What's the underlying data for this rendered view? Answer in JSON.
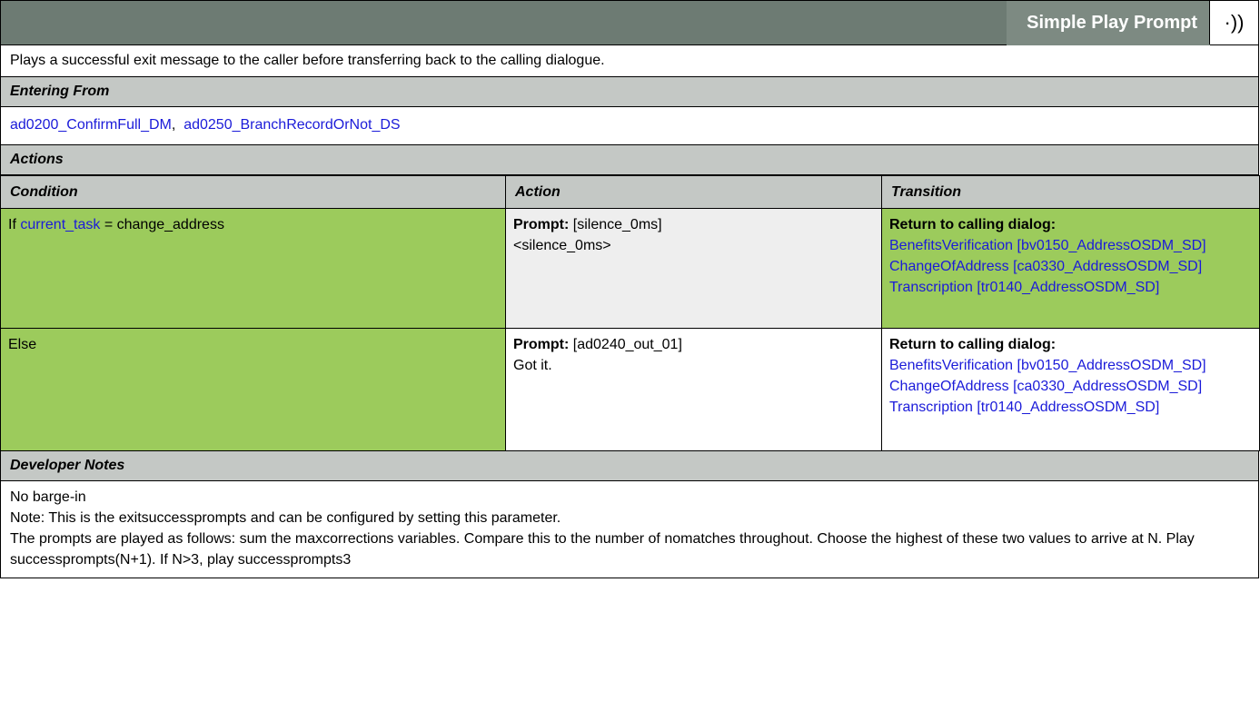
{
  "header": {
    "title": "Simple Play Prompt",
    "icon": "speaker-icon",
    "icon_glyph": "·))"
  },
  "description": "Plays a successful exit message to the caller before transferring back to the calling dialogue.",
  "entering_from": {
    "label": "Entering From",
    "links": [
      "ad0200_ConfirmFull_DM",
      "ad0250_BranchRecordOrNot_DS"
    ],
    "separator": ","
  },
  "actions": {
    "label": "Actions",
    "columns": [
      "Condition",
      "Action",
      "Transition"
    ],
    "rows": [
      {
        "cond_prefix": "If ",
        "cond_link": "current_task",
        "cond_suffix": " = change_address",
        "prompt_label": "Prompt:",
        "prompt_id": " [silence_0ms]",
        "prompt_text": "<silence_0ms>",
        "transition_label": "Return to calling dialog:",
        "transitions": [
          "BenefitsVerification [bv0150_AddressOSDM_SD]",
          "ChangeOfAddress [ca0330_AddressOSDM_SD]",
          "Transcription [tr0140_AddressOSDM_SD]"
        ]
      },
      {
        "cond_text": "Else",
        "prompt_label": "Prompt:",
        "prompt_id": " [ad0240_out_01]",
        "prompt_text": "Got it.",
        "transition_label": "Return to calling dialog:",
        "transitions": [
          "BenefitsVerification [bv0150_AddressOSDM_SD]",
          "ChangeOfAddress [ca0330_AddressOSDM_SD]",
          "Transcription [tr0140_AddressOSDM_SD]"
        ]
      }
    ]
  },
  "developer_notes": {
    "label": "Developer Notes",
    "lines": [
      "No barge-in",
      "Note: This is the exitsuccessprompts and can be configured by setting this parameter.",
      "The prompts are played as follows: sum the maxcorrections variables. Compare this to the number of nomatches throughout. Choose the highest of these two values to arrive at N. Play successprompts(N+1). If N>3,  play successprompts3"
    ]
  },
  "colors": {
    "title_bar": "#6d7b73",
    "section": "#c4c8c5",
    "green": "#9ccb5c",
    "link": "#1b1bd9"
  }
}
